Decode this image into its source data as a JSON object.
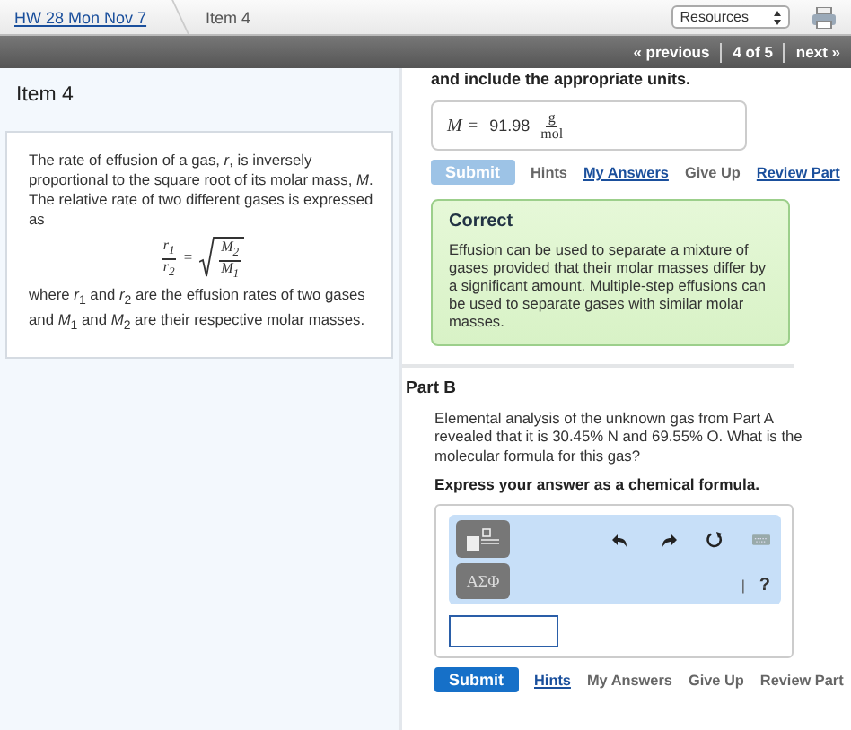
{
  "header": {
    "breadcrumb_link": "HW 28 Mon Nov 7",
    "breadcrumb_current": "Item 4",
    "resources_select": "Resources"
  },
  "pager": {
    "previous": "« previous",
    "position": "4 of 5",
    "next": "next »"
  },
  "item": {
    "title": "Item 4",
    "intro": "The rate of effusion of a gas, *r*, is inversely proportional to the square root of its molar mass, *M*. The relative rate of two different gases is expressed as",
    "formula": {
      "left_num": "r$_{1}$",
      "left_den": "r$_{2}$",
      "equals": "=",
      "right_num": "M$_{2}$",
      "right_den": "M$_{1}$"
    },
    "outro": "where *r*$_{1}$ and *r*$_{2}$ are the effusion rates of two gases and *M*$_{1}$ and *M*$_{2}$ are their respective molar masses."
  },
  "part_a": {
    "instruction": "and include the appropriate units.",
    "answer": {
      "variable": "M =",
      "value": "91.98",
      "unit_num": "g",
      "unit_den": "mol"
    },
    "actions": [
      {
        "kind": "submit",
        "label": "Submit",
        "disabled": true
      },
      {
        "kind": "text",
        "label": "Hints"
      },
      {
        "kind": "link",
        "label": "My Answers"
      },
      {
        "kind": "text",
        "label": "Give Up"
      },
      {
        "kind": "link",
        "label": "Review Part"
      }
    ],
    "feedback": {
      "title": "Correct",
      "text": "Effusion can be used to separate a mixture of gases provided that their molar masses differ by a significant amount. Multiple-step effusions can be used to separate gases with similar molar masses."
    }
  },
  "part_b": {
    "title": "Part B",
    "question": "Elemental analysis of the unknown gas from Part A revealed that it is 30.45% N and 69.55% O. What is the molecular formula for this gas?",
    "instruction": "Express your answer as a chemical formula.",
    "toolbar": {
      "symbols_button": "ΑΣΦ",
      "separator": "|",
      "help": "?"
    },
    "actions": [
      {
        "kind": "submit",
        "label": "Submit",
        "disabled": false
      },
      {
        "kind": "link",
        "label": "Hints"
      },
      {
        "kind": "text",
        "label": "My Answers"
      },
      {
        "kind": "text",
        "label": "Give Up"
      },
      {
        "kind": "text",
        "label": "Review Part"
      }
    ]
  }
}
